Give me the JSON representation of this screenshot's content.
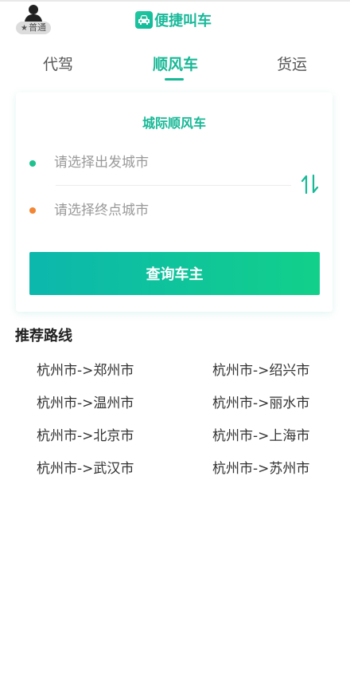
{
  "header": {
    "user_badge": "普通",
    "logo_text": "便捷叫车"
  },
  "tabs": [
    {
      "label": "代驾"
    },
    {
      "label": "顺风车"
    },
    {
      "label": "货运"
    }
  ],
  "active_tab": "顺风车",
  "card": {
    "title": "城际顺风车",
    "start_placeholder": "请选择出发城市",
    "start_value": "",
    "end_placeholder": "请选择终点城市",
    "end_value": "",
    "query_button": "查询车主"
  },
  "routes_section": {
    "title": "推荐路线",
    "routes": [
      "杭州市->郑州市",
      "杭州市->绍兴市",
      "杭州市->温州市",
      "杭州市->丽水市",
      "杭州市->北京市",
      "杭州市->上海市",
      "杭州市->武汉市",
      "杭州市->苏州市"
    ]
  },
  "colors": {
    "brand": "#17b896",
    "start_dot": "#1ec28e",
    "end_dot": "#f28633",
    "button_gradient_from": "#0cb7ad",
    "button_gradient_to": "#12d08a"
  },
  "icons": [
    "user-icon",
    "star-icon",
    "car-logo-icon",
    "swap-arrows-icon"
  ]
}
